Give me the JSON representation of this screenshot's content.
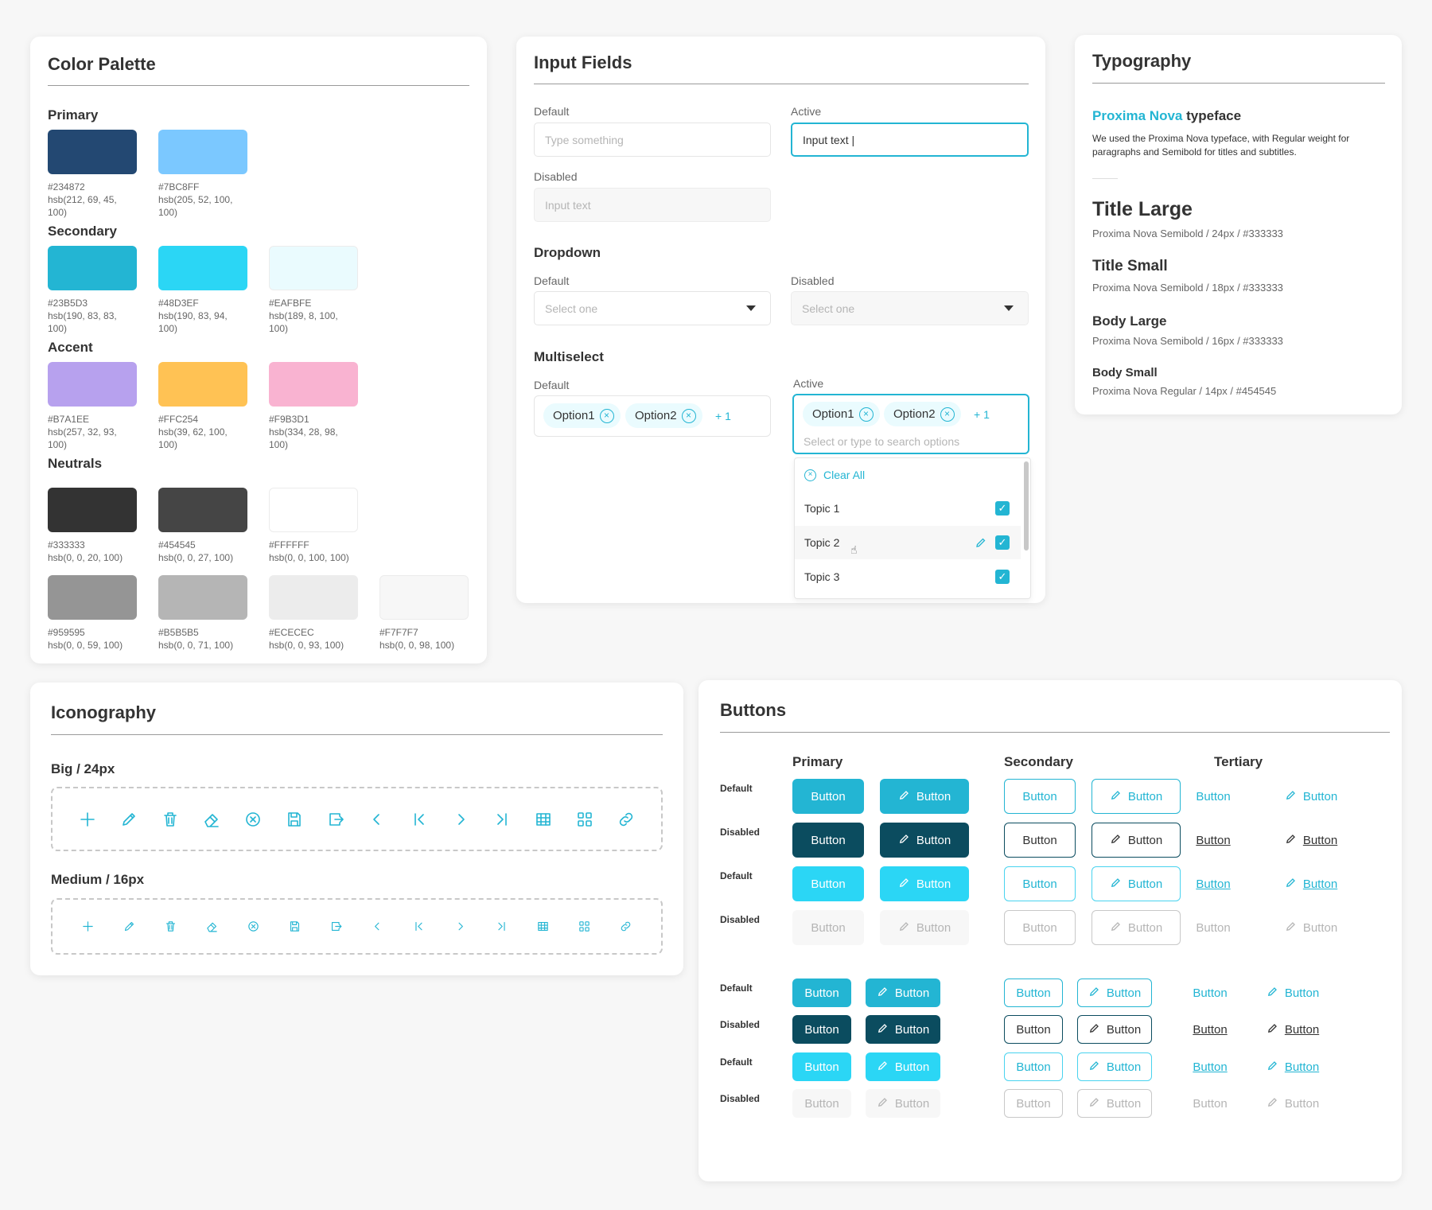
{
  "color_palette": {
    "title": "Color Palette",
    "groups": [
      {
        "label": "Primary",
        "swatches": [
          {
            "hex": "#234872",
            "hsb": "hsb(212, 69, 45, 100)",
            "color": "#234872"
          },
          {
            "hex": "#7BC8FF",
            "hsb": "hsb(205, 52, 100, 100)",
            "color": "#7BC8FF"
          }
        ]
      },
      {
        "label": "Secondary",
        "swatches": [
          {
            "hex": "#23B5D3",
            "hsb": "hsb(190, 83, 83, 100)",
            "color": "#23B5D3"
          },
          {
            "hex": "#48D3EF",
            "hsb": "hsb(190, 83, 94, 100)",
            "color": "#2BD6F5"
          },
          {
            "hex": "#EAFBFE",
            "hsb": "hsb(189, 8, 100, 100)",
            "color": "#EAFBFE"
          }
        ]
      },
      {
        "label": "Accent",
        "swatches": [
          {
            "hex": "#B7A1EE",
            "hsb": "hsb(257, 32, 93, 100)",
            "color": "#B7A1EE"
          },
          {
            "hex": "#FFC254",
            "hsb": "hsb(39, 62, 100, 100)",
            "color": "#FFC254"
          },
          {
            "hex": "#F9B3D1",
            "hsb": "hsb(334, 28, 98, 100)",
            "color": "#F9B3D1"
          }
        ]
      },
      {
        "label": "Neutrals",
        "swatches": [
          {
            "hex": "#333333",
            "hsb": "hsb(0, 0, 20, 100)",
            "color": "#333333"
          },
          {
            "hex": "#454545",
            "hsb": "hsb(0, 0, 27, 100)",
            "color": "#454545"
          },
          {
            "hex": "#FFFFFF",
            "hsb": "hsb(0, 0, 100, 100)",
            "color": "#FFFFFF"
          },
          {
            "hex": "#959595",
            "hsb": "hsb(0, 0, 59, 100)",
            "color": "#959595"
          },
          {
            "hex": "#B5B5B5",
            "hsb": "hsb(0, 0, 71, 100)",
            "color": "#B5B5B5"
          },
          {
            "hex": "#ECECEC",
            "hsb": "hsb(0, 0, 93, 100)",
            "color": "#ECECEC"
          },
          {
            "hex": "#F7F7F7",
            "hsb": "hsb(0, 0, 98, 100)",
            "color": "#F7F7F7"
          }
        ]
      }
    ]
  },
  "input_fields": {
    "title": "Input Fields",
    "default_label": "Default",
    "default_placeholder": "Type something",
    "active_label": "Active",
    "active_value": "Input text |",
    "disabled_label": "Disabled",
    "disabled_value": "Input text",
    "dropdown": {
      "title": "Dropdown",
      "default_label": "Default",
      "default_placeholder": "Select one",
      "disabled_label": "Disabled",
      "disabled_placeholder": "Select one"
    },
    "multiselect": {
      "title": "Multiselect",
      "default_label": "Default",
      "active_label": "Active",
      "chips": [
        "Option1",
        "Option2"
      ],
      "more": "+ 1",
      "search_placeholder": "Select or type to search options",
      "clear_all": "Clear All",
      "topics": [
        "Topic 1",
        "Topic 2",
        "Topic 3"
      ]
    }
  },
  "typography": {
    "title": "Typography",
    "face_accent": "Proxima Nova",
    "face_rest": " typeface",
    "description": "We used the Proxima Nova typeface, with Regular weight for paragraphs and Semibold for titles and subtitles.",
    "styles": [
      {
        "name": "Title Large",
        "spec": "Proxima Nova Semibold / 24px / #333333"
      },
      {
        "name": "Title Small",
        "spec": "Proxima Nova Semibold / 18px / #333333"
      },
      {
        "name": "Body Large",
        "spec": "Proxima Nova Semibold / 16px / #333333"
      },
      {
        "name": "Body Small",
        "spec": "Proxima Nova Regular / 14px / #454545"
      }
    ]
  },
  "iconography": {
    "title": "Iconography",
    "big_label": "Big / 24px",
    "medium_label": "Medium / 16px",
    "icons": [
      "plus-icon",
      "pencil-icon",
      "trash-icon",
      "eraser-icon",
      "close-circle-icon",
      "save-icon",
      "export-icon",
      "chevron-left-icon",
      "first-page-icon",
      "chevron-right-icon",
      "last-page-icon",
      "table-icon",
      "grid-icon",
      "link-icon"
    ],
    "accent": "#23b5d3"
  },
  "buttons": {
    "title": "Buttons",
    "columns": [
      "Primary",
      "Secondary",
      "Tertiary"
    ],
    "rows": [
      "Default",
      "Disabled",
      "Default",
      "Disabled"
    ],
    "label": "Button"
  }
}
